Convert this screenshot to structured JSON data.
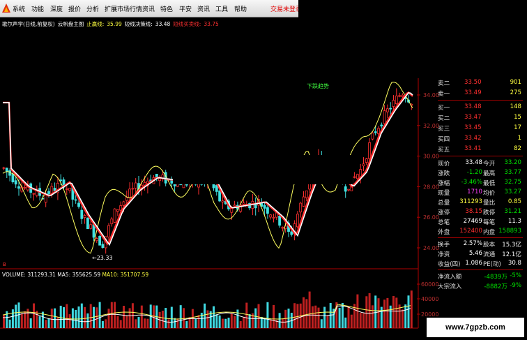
{
  "menu": {
    "items": [
      "系统",
      "功能",
      "深度",
      "报价",
      "分析",
      "扩展市场行情",
      "资讯",
      "特色",
      "平安",
      "资讯",
      "工具",
      "帮助"
    ],
    "trade_link": "交易未登录"
  },
  "infobar": {
    "stock": "歌尔声学(日线,前复权)",
    "indicator": "云帆盘主图",
    "stop_label": "止赢线:",
    "stop_value": "35.99",
    "short_label": "短线决策线:",
    "short_value": "33.48",
    "buy_label": "短线买卖线:",
    "buy_value": "33.75"
  },
  "chart": {
    "trend_label": "下跌趋势",
    "low_annotation": "←23.33",
    "marker": "B",
    "price_ticks": [
      "34.00",
      "32.00",
      "30.00",
      "28.00",
      "26.00",
      "24.00"
    ],
    "volume_ticks": [
      "60000",
      "40000",
      "20000"
    ],
    "colors": {
      "up": "#ff3030",
      "down": "#40e0e0",
      "ma_yellow": "#ffff60",
      "ma_red": "#ff3030",
      "ma_white": "#ffffff",
      "axis": "#b00000"
    }
  },
  "volume_info": {
    "label": "VOLUME:",
    "value": "311293.31",
    "ma5_label": "MA5:",
    "ma5": "355625.59",
    "ma10_label": "MA10:",
    "ma10": "351707.59"
  },
  "orderbook": {
    "asks": [
      {
        "label": "卖二",
        "price": "33.50",
        "vol": "901"
      },
      {
        "label": "卖一",
        "price": "33.49",
        "vol": "275"
      }
    ],
    "bids": [
      {
        "label": "买一",
        "price": "33.48",
        "vol": "148"
      },
      {
        "label": "买二",
        "price": "33.47",
        "vol": "15"
      },
      {
        "label": "买三",
        "price": "33.45",
        "vol": "17"
      },
      {
        "label": "买四",
        "price": "33.42",
        "vol": "1"
      },
      {
        "label": "买五",
        "price": "33.41",
        "vol": "82"
      }
    ]
  },
  "quote": {
    "rows": [
      {
        "l1": "现价",
        "v1": "33.48",
        "c1": "white",
        "l2": "今开",
        "v2": "33.20",
        "c2": "green"
      },
      {
        "l1": "涨跌",
        "v1": "-1.20",
        "c1": "green",
        "l2": "最高",
        "v2": "33.77",
        "c2": "green"
      },
      {
        "l1": "涨幅",
        "v1": "-3.46%",
        "c1": "green",
        "l2": "最低",
        "v2": "32.75",
        "c2": "green"
      },
      {
        "l1": "现量",
        "v1": "1710",
        "c1": "magenta",
        "l2": "均价",
        "v2": "33.27",
        "c2": "green"
      },
      {
        "l1": "总量",
        "v1": "311293",
        "c1": "yellow",
        "l2": "量比",
        "v2": "0.85",
        "c2": "yellow"
      },
      {
        "l1": "涨停",
        "v1": "38.15",
        "c1": "red",
        "l2": "跌停",
        "v2": "31.21",
        "c2": "green"
      },
      {
        "l1": "总笔",
        "v1": "27469",
        "c1": "white",
        "l2": "每笔",
        "v2": "11.3",
        "c2": "white"
      },
      {
        "l1": "外盘",
        "v1": "152400",
        "c1": "red",
        "l2": "内盘",
        "v2": "158893",
        "c2": "green"
      }
    ],
    "rows2": [
      {
        "l1": "换手",
        "v1": "2.57%",
        "l2": "股本",
        "v2": "15.3亿"
      },
      {
        "l1": "净资",
        "v1": "5.46",
        "l2": "流通",
        "v2": "12.1亿"
      },
      {
        "l1": "收益(四)",
        "v1": "1.086",
        "l2": "PE(动)",
        "v2": "30.8"
      }
    ],
    "flow": [
      {
        "label": "净流入额",
        "v1": "-4839万",
        "v2": "-5%"
      },
      {
        "label": "大宗流入",
        "v1": "-8882万",
        "v2": "-9%"
      }
    ]
  },
  "watermark": "www.7gpzb.com"
}
